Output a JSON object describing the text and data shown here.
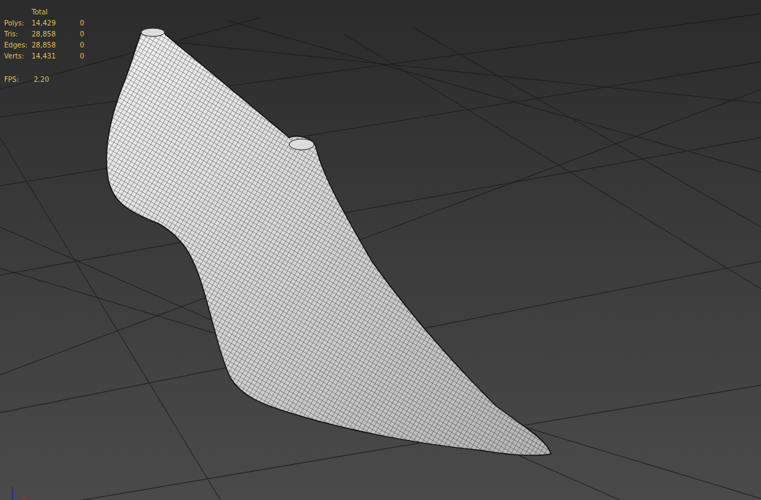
{
  "viewport": {
    "stats": {
      "header": "Total",
      "rows": [
        {
          "label": "Polys:",
          "total": "14,429",
          "selected": "0"
        },
        {
          "label": "Tris:",
          "total": "28,858",
          "selected": "0"
        },
        {
          "label": "Edges:",
          "total": "28,858",
          "selected": "0"
        },
        {
          "label": "Verts:",
          "total": "14,431",
          "selected": "0"
        }
      ],
      "fps": {
        "label": "FPS:",
        "value": "2.20"
      }
    }
  }
}
